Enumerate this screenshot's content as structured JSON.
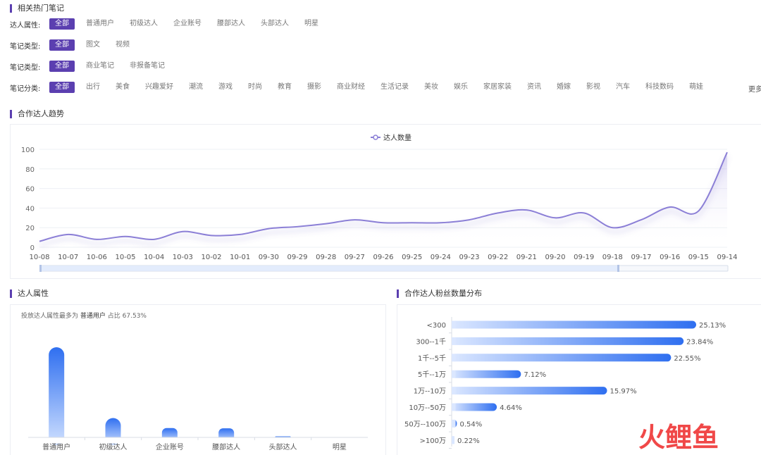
{
  "sections": {
    "hot_notes": "相关热门笔记",
    "trend": "合作达人趋势",
    "attr": "达人属性",
    "fans": "合作达人粉丝数量分布"
  },
  "filters": [
    {
      "label": "达人属性:",
      "options": [
        "全部",
        "普通用户",
        "初级达人",
        "企业账号",
        "腰部达人",
        "头部达人",
        "明星"
      ]
    },
    {
      "label": "笔记类型:",
      "options": [
        "全部",
        "图文",
        "视频"
      ]
    },
    {
      "label": "笔记类型:",
      "options": [
        "全部",
        "商业笔记",
        "非报备笔记"
      ]
    },
    {
      "label": "笔记分类:",
      "options": [
        "全部",
        "出行",
        "美食",
        "兴趣爱好",
        "潮流",
        "游戏",
        "时尚",
        "教育",
        "摄影",
        "商业财经",
        "生活记录",
        "美妆",
        "娱乐",
        "家居家装",
        "资讯",
        "婚嫁",
        "影视",
        "汽车",
        "科技数码",
        "萌娃"
      ]
    }
  ],
  "more_label": "更多",
  "summary": {
    "prefix": "投放达人属性最多为",
    "value": "普通用户",
    "ratio_label": "占比",
    "ratio": "67.53%"
  },
  "watermark": "火鲤鱼",
  "colors": {
    "accent": "#5b3fb0",
    "line": "#8b7fd6",
    "bar_blue": "#2f6ff0",
    "bar_light": "#d6e4ff"
  },
  "chart_data": [
    {
      "type": "line",
      "legend": "达人数量",
      "legend_position": "top-center",
      "x": [
        "10-08",
        "10-07",
        "10-06",
        "10-05",
        "10-04",
        "10-03",
        "10-02",
        "10-01",
        "09-30",
        "09-29",
        "09-28",
        "09-27",
        "09-26",
        "09-25",
        "09-24",
        "09-23",
        "09-22",
        "09-21",
        "09-20",
        "09-19",
        "09-18",
        "09-17",
        "09-16",
        "09-15",
        "09-14"
      ],
      "values": [
        6,
        13,
        8,
        11,
        8,
        16,
        12,
        13,
        19,
        21,
        24,
        28,
        25,
        25,
        25,
        28,
        35,
        38,
        30,
        35,
        20,
        28,
        41,
        37,
        97
      ],
      "yticks": [
        0,
        20,
        40,
        60,
        80,
        100
      ],
      "ylim": [
        0,
        100
      ],
      "grid": true
    },
    {
      "type": "bar",
      "categories": [
        "普通用户",
        "初级达人",
        "企业账号",
        "腰部达人",
        "头部达人",
        "明星"
      ],
      "values": [
        67.53,
        14.5,
        7.0,
        6.8,
        0.8,
        0.0
      ],
      "ylim": [
        0,
        70
      ]
    },
    {
      "type": "bar",
      "orientation": "horizontal",
      "categories": [
        "<300",
        "300--1千",
        "1千--5千",
        "5千--1万",
        "1万--10万",
        "10万--50万",
        "50万--100万",
        ">100万"
      ],
      "values": [
        25.13,
        23.84,
        22.55,
        7.12,
        15.97,
        4.64,
        0.54,
        0.22
      ],
      "labels": [
        "25.13%",
        "23.84%",
        "22.55%",
        "7.12%",
        "15.97%",
        "4.64%",
        "0.54%",
        "0.22%"
      ],
      "xlim": [
        0,
        26
      ]
    }
  ]
}
